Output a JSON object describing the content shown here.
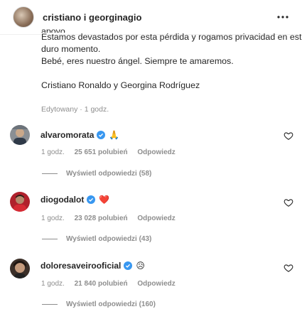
{
  "header": {
    "title": "cristiano i georginagio",
    "more_icon": "more-horizontal-icon"
  },
  "caption": {
    "partial_line": "apoyo.",
    "lines": [
      "Estamos devastados por esta pérdida y rogamos privacidad en este",
      "duro momento.",
      "Bebé, eres nuestro ángel. Siempre te amaremos."
    ],
    "signature": "Cristiano Ronaldo y Georgina Rodríguez",
    "edited": "Edytowany · 1 godz."
  },
  "comments": [
    {
      "username": "alvaromorata",
      "verified": true,
      "emoji": "🙏",
      "time": "1 godz.",
      "likes": "25 651 polubień",
      "reply": "Odpowiedz",
      "view_replies": "Wyświetl odpowiedzi (58)"
    },
    {
      "username": "diogodalot",
      "verified": true,
      "emoji": "❤️",
      "time": "1 godz.",
      "likes": "23 028 polubień",
      "reply": "Odpowiedz",
      "view_replies": "Wyświetl odpowiedzi (43)"
    },
    {
      "username": "doloresaveirooficial",
      "verified": true,
      "emoji": "😥",
      "time": "1 godz.",
      "likes": "21 840 polubień",
      "reply": "Odpowiedz",
      "view_replies": "Wyświetl odpowiedzi (160)"
    }
  ],
  "colors": {
    "verified_blue": "#3897f0",
    "secondary_text": "#8e8e8e",
    "heart_red": "#ed4956"
  }
}
